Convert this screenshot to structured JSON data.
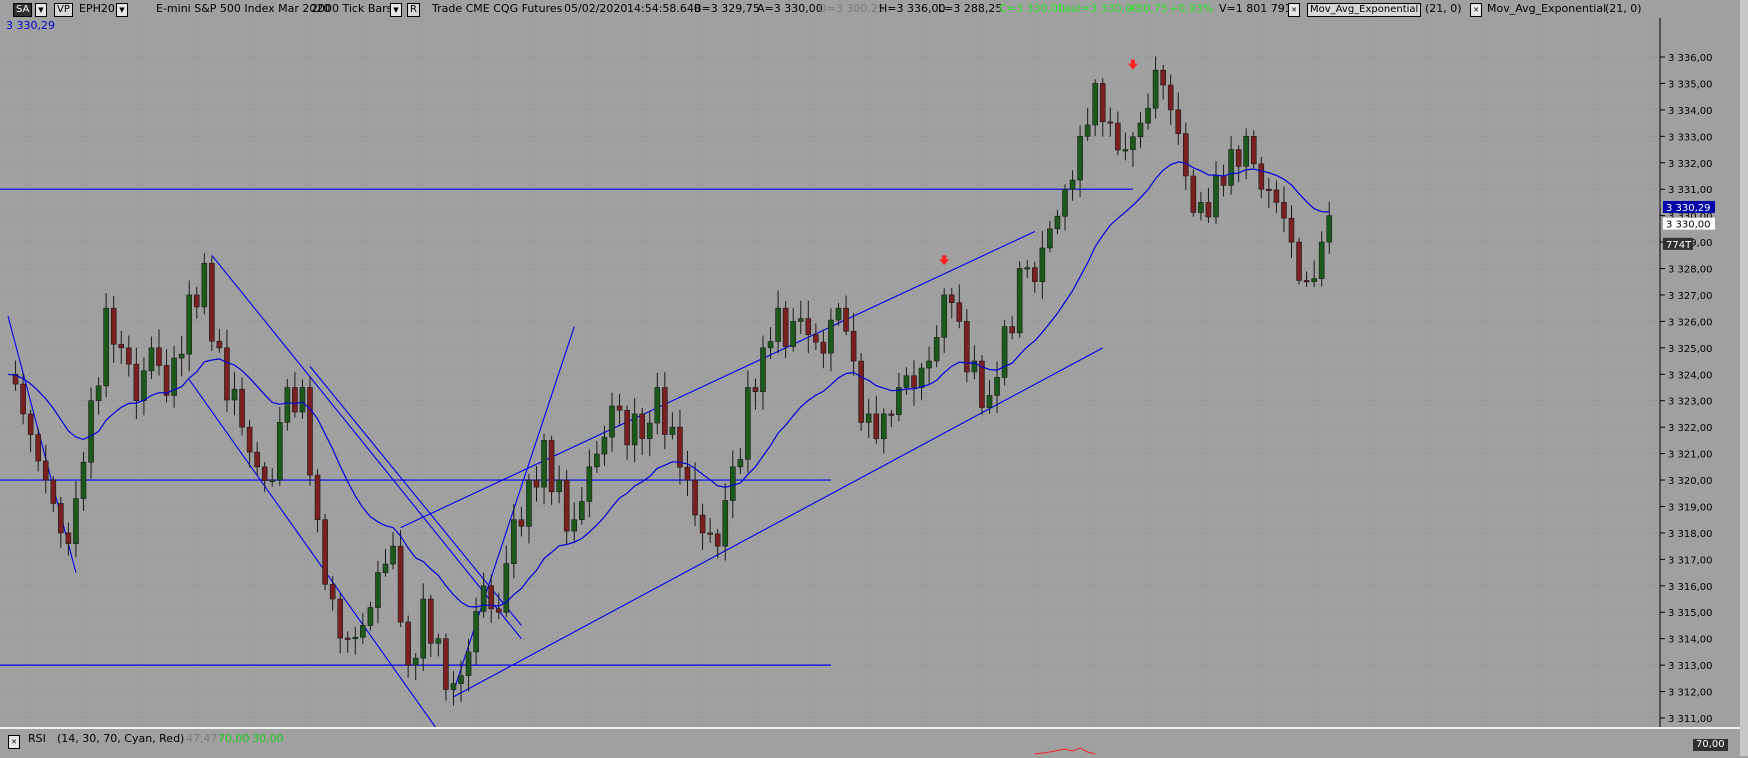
{
  "toolbar": {
    "study_button": "SA",
    "vp_button": "VP",
    "symbol": "EPH20",
    "description": "E-mini S&P 500 Index Mar 2020",
    "bar_type": "2000 Tick Bars",
    "mode_button": "R",
    "trade_info": "Trade CME CQG Futures",
    "date": "05/02/2020",
    "time": "14:54:58.640",
    "bid": "B=3 329,75",
    "ask": "A=3 330,00",
    "open": "O=3 300,25",
    "high": "H=3 336,00",
    "low": "L=3 288,25",
    "change": "C=3 330,00",
    "last": "Last=3 330,00",
    "net_change": "+30,75",
    "pct_change": "+0,93%",
    "volume": "V=1 801 791",
    "study1_name": "Mov_Avg_Exponential",
    "study1_params": "(21, 0)",
    "study2_name": "Mov_Avg_Exponential",
    "study2_params": "(21, 0)"
  },
  "sub_value": "3 330,29",
  "rsi": {
    "label": "RSI",
    "params": "(14, 30, 70, Cyan, Red)",
    "value": "47,47",
    "upper": "70,00",
    "lower": "30,00",
    "axis_value": "70,00"
  },
  "colors": {
    "background": "#a0a0a0",
    "up_candle": "#1c5a1c",
    "down_candle": "#7a2020",
    "ema": "#0000dd",
    "trendline": "#0000ee",
    "signal_arrow": "#ff2020",
    "price_tag": "#0000aa"
  },
  "chart_data": {
    "type": "candlestick",
    "y_axis": {
      "min": 3310.5,
      "max": 3336.5,
      "ticks": [
        "3 311,00",
        "3 312,00",
        "3 313,00",
        "3 314,00",
        "3 315,00",
        "3 316,00",
        "3 317,00",
        "3 318,00",
        "3 319,00",
        "3 320,00",
        "3 321,00",
        "3 322,00",
        "3 323,00",
        "3 324,00",
        "3 325,00",
        "3 326,00",
        "3 327,00",
        "3 328,00",
        "3 329,00",
        "3 330,00",
        "3 331,00",
        "3 332,00",
        "3 333,00",
        "3 334,00",
        "3 335,00",
        "3 336,00"
      ],
      "tick_values": [
        3311,
        3312,
        3313,
        3314,
        3315,
        3316,
        3317,
        3318,
        3319,
        3320,
        3321,
        3322,
        3323,
        3324,
        3325,
        3326,
        3327,
        3328,
        3329,
        3330,
        3331,
        3332,
        3333,
        3334,
        3335,
        3336
      ],
      "position": "right"
    },
    "x_bar_range": [
      0,
      194
    ],
    "grid": true,
    "price_labels": [
      {
        "value": 3330.29,
        "text": "3 330,29",
        "style": "ema"
      },
      {
        "value": 3330.0,
        "text": "3 330,00",
        "style": "last"
      },
      {
        "value": 3329.5,
        "text": "774T",
        "style": "ticks"
      }
    ],
    "anchors": [
      [
        0,
        3324
      ],
      [
        2,
        3322.5
      ],
      [
        5,
        3320
      ],
      [
        7,
        3318
      ],
      [
        9,
        3319.3
      ],
      [
        11,
        3323
      ],
      [
        13,
        3326.5
      ],
      [
        15,
        3325
      ],
      [
        17,
        3323
      ],
      [
        19,
        3325
      ],
      [
        21,
        3323.2
      ],
      [
        24,
        3327
      ],
      [
        26,
        3328.2
      ],
      [
        28,
        3325
      ],
      [
        31,
        3322
      ],
      [
        33,
        3320.5
      ],
      [
        35,
        3320
      ],
      [
        37,
        3323.5
      ],
      [
        39,
        3323.5
      ],
      [
        41,
        3318.5
      ],
      [
        43,
        3315.5
      ],
      [
        45,
        3314
      ],
      [
        47,
        3314.5
      ],
      [
        49,
        3316.5
      ],
      [
        51,
        3317.5
      ],
      [
        53,
        3313
      ],
      [
        55,
        3315.5
      ],
      [
        57,
        3314
      ],
      [
        59,
        3312.3
      ],
      [
        61,
        3313.5
      ],
      [
        63,
        3316
      ],
      [
        65,
        3315
      ],
      [
        67,
        3318.5
      ],
      [
        69,
        3320
      ],
      [
        71,
        3321.5
      ],
      [
        73,
        3320
      ],
      [
        75,
        3318.5
      ],
      [
        77,
        3320.5
      ],
      [
        80,
        3322.8
      ],
      [
        83,
        3322.5
      ],
      [
        86,
        3323.5
      ],
      [
        88,
        3322
      ],
      [
        90,
        3320
      ],
      [
        92,
        3318
      ],
      [
        94,
        3317.5
      ],
      [
        96,
        3320.5
      ],
      [
        98,
        3323.5
      ],
      [
        100,
        3325
      ],
      [
        102,
        3326.5
      ],
      [
        104,
        3326
      ],
      [
        106,
        3325.5
      ],
      [
        108,
        3324.8
      ],
      [
        110,
        3326.5
      ],
      [
        112,
        3324.5
      ],
      [
        114,
        3322.5
      ],
      [
        116,
        3322.5
      ],
      [
        118,
        3323.5
      ],
      [
        120,
        3323.5
      ],
      [
        122,
        3324.5
      ],
      [
        124,
        3327
      ],
      [
        126,
        3326
      ],
      [
        128,
        3324.5
      ],
      [
        130,
        3323.2
      ],
      [
        132,
        3325.8
      ],
      [
        134,
        3328
      ],
      [
        136,
        3327.5
      ],
      [
        138,
        3329.5
      ],
      [
        140,
        3331
      ],
      [
        142,
        3333
      ],
      [
        144,
        3335
      ],
      [
        146,
        3333.5
      ],
      [
        148,
        3332.5
      ],
      [
        150,
        3333.5
      ],
      [
        152,
        3335.5
      ],
      [
        154,
        3334
      ],
      [
        156,
        3331.5
      ],
      [
        158,
        3330.5
      ],
      [
        160,
        3331.5
      ],
      [
        162,
        3332.5
      ],
      [
        164,
        3333
      ],
      [
        166,
        3331
      ],
      [
        168,
        3330.5
      ],
      [
        170,
        3329
      ],
      [
        172,
        3327.5
      ],
      [
        174,
        3329
      ],
      [
        175,
        3330
      ]
    ],
    "ema_period": 21,
    "ema_series_name": "Mov_Avg_Exponential (21, 0)",
    "signal_arrows": [
      {
        "bar": 124,
        "value": 3328.2,
        "direction": "down"
      },
      {
        "bar": 149,
        "value": 3335.6,
        "direction": "down"
      }
    ],
    "horizontal_lines": [
      {
        "value": 3331.0,
        "from_bar": 0,
        "to_bar": 149
      },
      {
        "value": 3320.0,
        "from_bar": 0,
        "to_bar": 109
      },
      {
        "value": 3313.0,
        "from_bar": 0,
        "to_bar": 109
      }
    ],
    "trendlines": [
      {
        "from": [
          0,
          3326.2
        ],
        "to": [
          9,
          3316.5
        ]
      },
      {
        "from": [
          27,
          3328.5
        ],
        "to": [
          68,
          3314
        ]
      },
      {
        "from": [
          24,
          3323.8
        ],
        "to": [
          57,
          3310.5
        ]
      },
      {
        "from": [
          59,
          3312
        ],
        "to": [
          75,
          3325.8
        ]
      },
      {
        "from": [
          59,
          3311.8
        ],
        "to": [
          145,
          3325
        ]
      },
      {
        "from": [
          52,
          3318.2
        ],
        "to": [
          136,
          3329.4
        ]
      },
      {
        "from": [
          40,
          3324.3
        ],
        "to": [
          68,
          3314.5
        ]
      }
    ],
    "rsi_series": [
      [
        136,
        0.2
      ],
      [
        138,
        0.4
      ],
      [
        140,
        0.7
      ],
      [
        141,
        0.5
      ],
      [
        142,
        0.8
      ],
      [
        143,
        0.4
      ],
      [
        144,
        0.2
      ]
    ]
  }
}
